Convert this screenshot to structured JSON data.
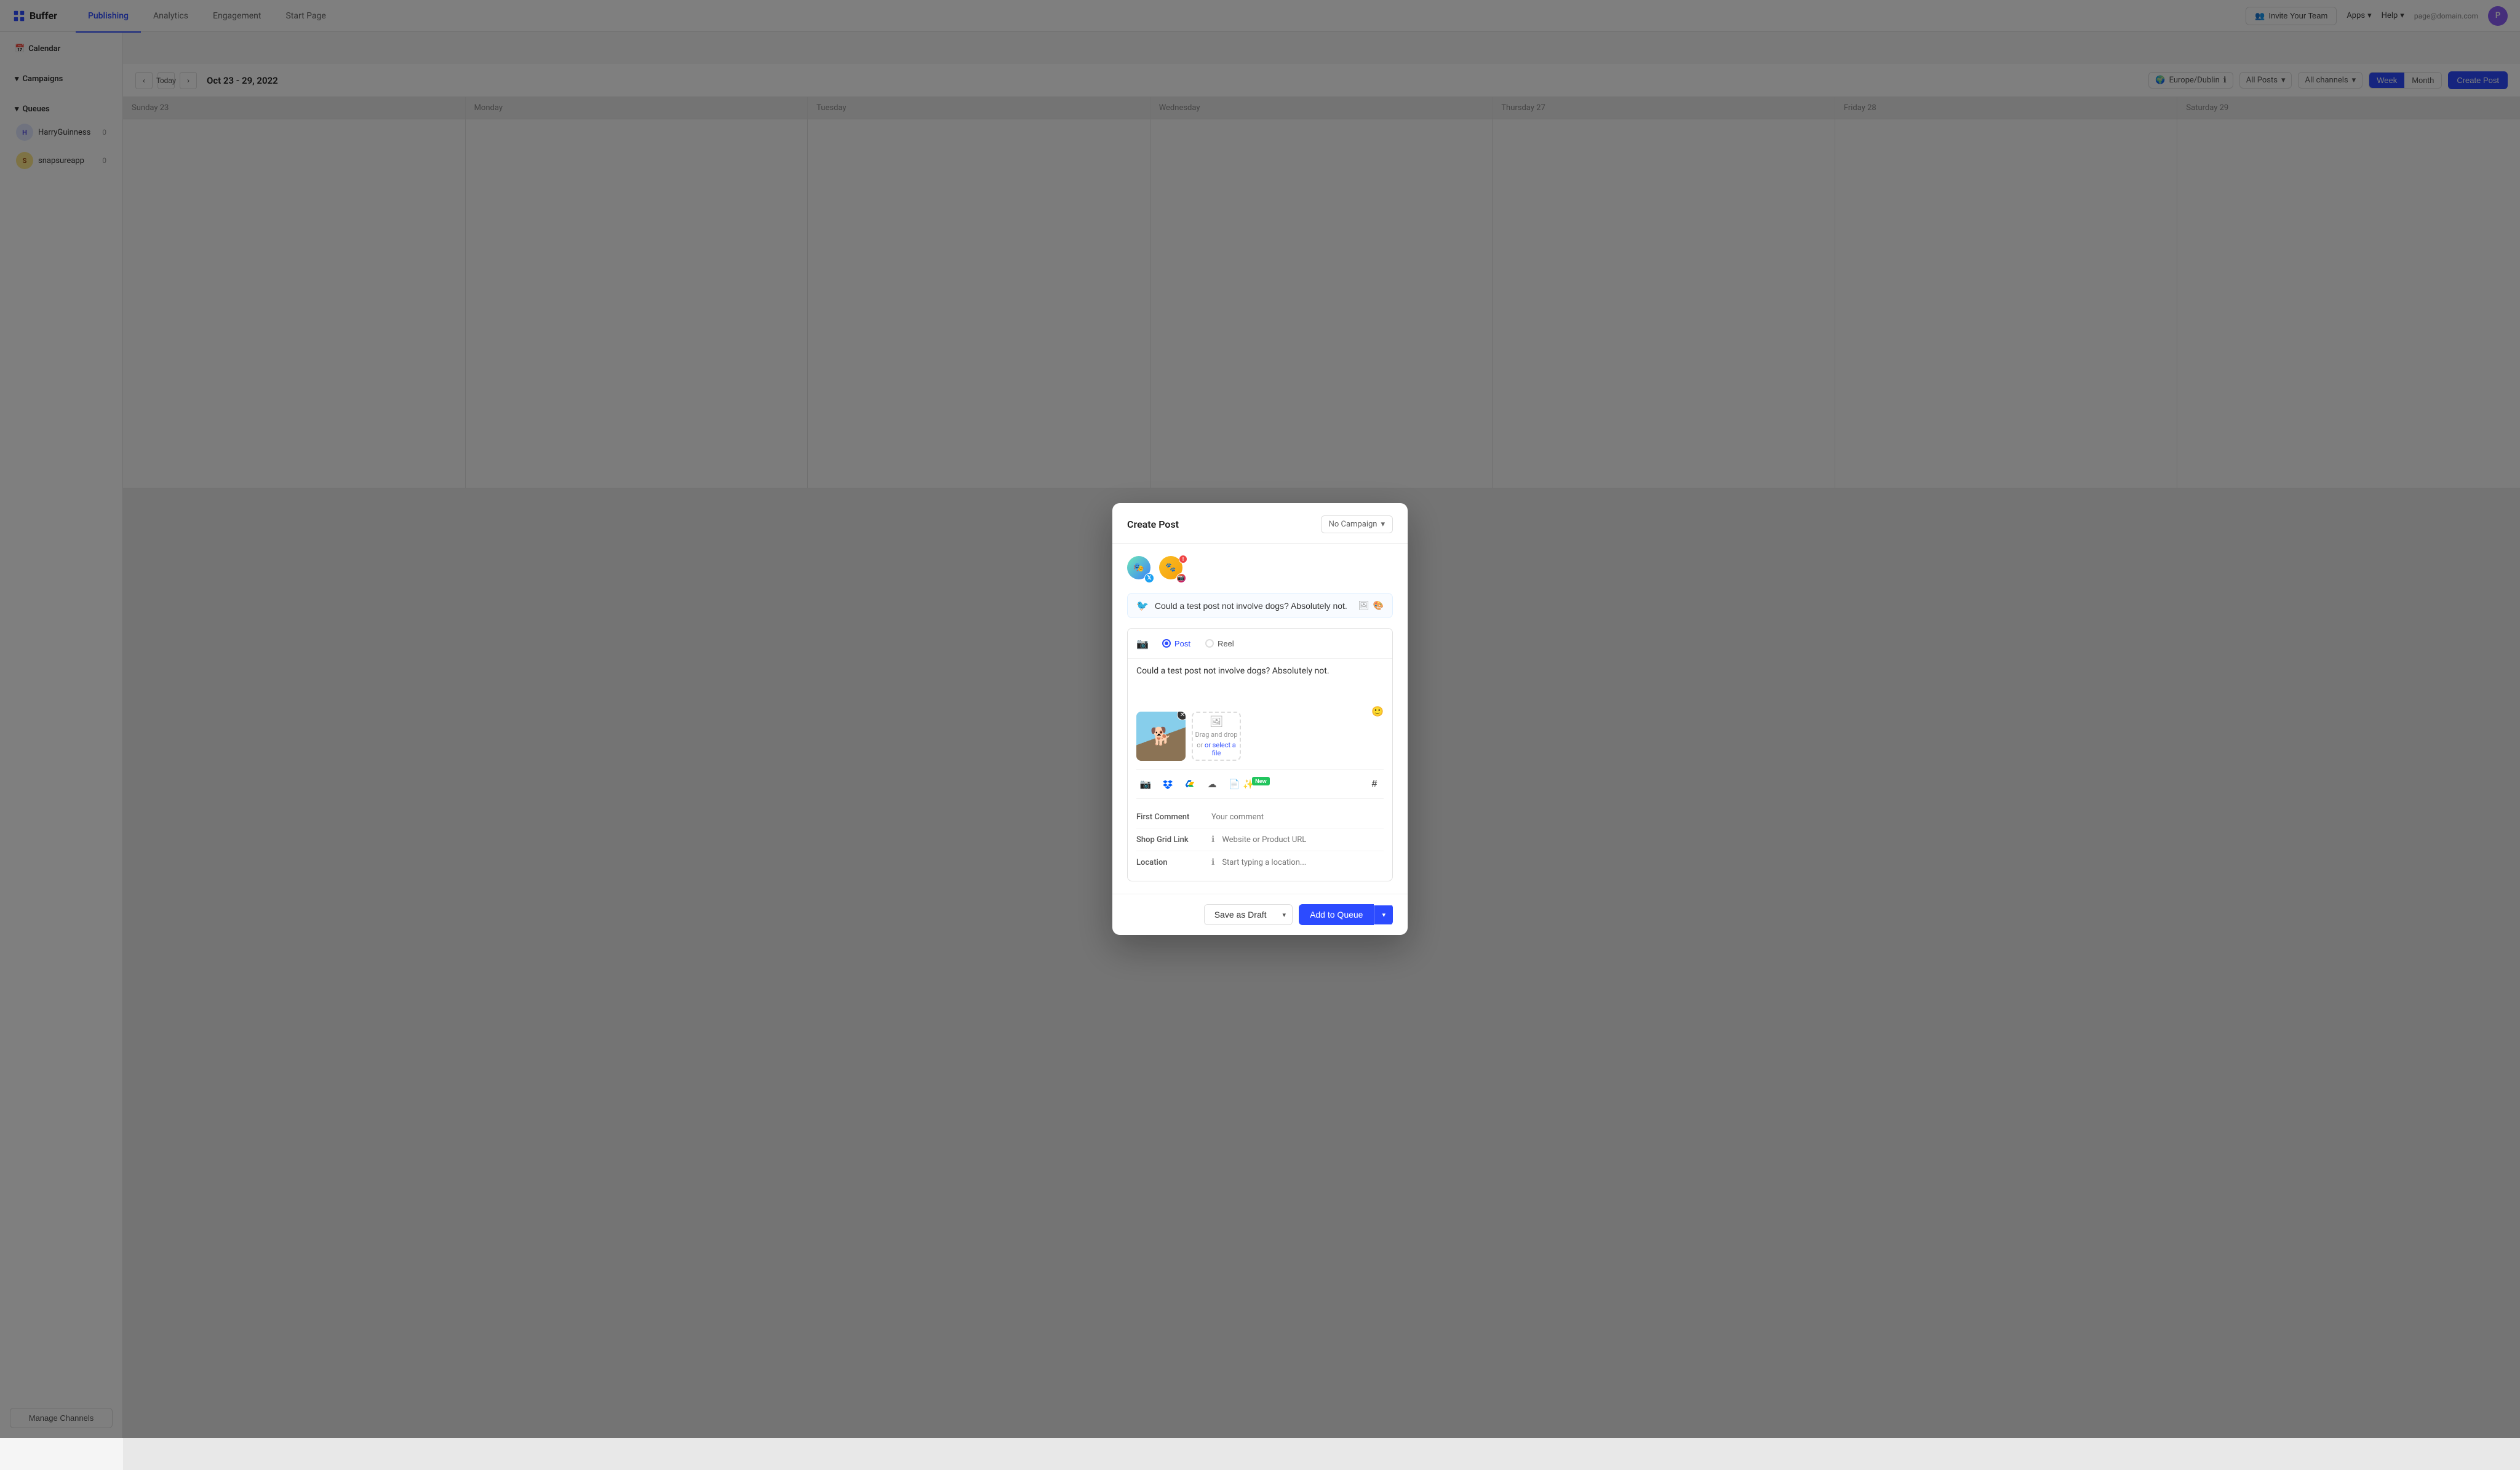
{
  "app": {
    "logo": "Buffer",
    "nav_tabs": [
      "Publishing",
      "Analytics",
      "Engagement",
      "Start Page"
    ],
    "active_tab": "Publishing"
  },
  "topnav": {
    "invite_label": "Invite Your Team",
    "apps_label": "Apps",
    "help_label": "Help",
    "user_email": "page@domain.com"
  },
  "sidebar": {
    "calendar_label": "Calendar",
    "campaigns_label": "Campaigns",
    "queues_label": "Queues",
    "accounts": [
      {
        "name": "HarryGuinness",
        "count": "0"
      },
      {
        "name": "snapsureapp",
        "count": "0"
      }
    ],
    "manage_channels": "Manage Channels"
  },
  "calendar": {
    "today_label": "Today",
    "date_range": "Oct 23 - 29, 2022",
    "timezone": "Europe/Dublin",
    "filter_label": "All Posts",
    "channels_label": "All channels",
    "views": [
      "Week",
      "Month"
    ],
    "active_view": "Week",
    "create_post": "Create Post",
    "days": [
      "Sunday 23",
      "Monday",
      "Tuesday",
      "Wednesday",
      "Thursday 27",
      "Friday 28",
      "Saturday 29"
    ]
  },
  "modal": {
    "title": "Create Post",
    "campaign_placeholder": "No Campaign",
    "accounts": [
      {
        "id": "twitter",
        "type": "twitter"
      },
      {
        "id": "instagram",
        "type": "instagram"
      }
    ],
    "twitter": {
      "placeholder": "Could a test post not involve dogs? Absolutely not.",
      "text": "Could a test post not involve dogs? Absolutely not."
    },
    "instagram": {
      "post_tab": "Post",
      "reel_tab": "Reel",
      "text": "Could a test post not involve dogs? Absolutely not.",
      "upload_text": "Drag and drop",
      "upload_text2": "or select a file"
    },
    "tools": {
      "icons": [
        "camera",
        "dropbox",
        "cloud-upload",
        "googledrive",
        "file",
        "magic"
      ]
    },
    "first_comment": {
      "label": "First Comment",
      "placeholder": "Your comment"
    },
    "shop_grid_link": {
      "label": "Shop Grid Link",
      "placeholder": "Website or Product URL"
    },
    "location": {
      "label": "Location",
      "placeholder": "Start typing a location..."
    },
    "footer": {
      "save_draft": "Save as Draft",
      "add_queue": "Add to Queue"
    }
  }
}
